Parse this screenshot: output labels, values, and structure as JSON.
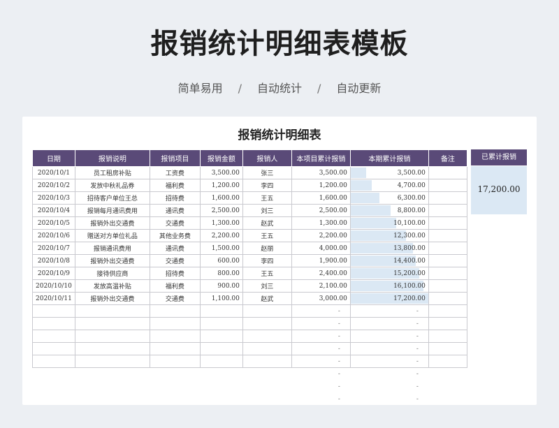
{
  "page": {
    "title": "报销统计明细表模板",
    "subtitle": [
      "简单易用",
      "自动统计",
      "自动更新"
    ],
    "separator": "/"
  },
  "sheet": {
    "title": "报销统计明细表",
    "headers": [
      "日期",
      "报销说明",
      "报销项目",
      "报销金额",
      "报销人",
      "本项目累计报销",
      "本期累计报销",
      "备注"
    ],
    "rows": [
      {
        "date": "2020/10/1",
        "desc": "员工租房补贴",
        "item": "工资费",
        "amount": "3,500.00",
        "person": "张三",
        "item_total": "3,500.00",
        "period_total": "3,500.00",
        "period_ratio": 0.2035,
        "note": ""
      },
      {
        "date": "2020/10/2",
        "desc": "发放中秋礼品券",
        "item": "福利费",
        "amount": "1,200.00",
        "person": "李四",
        "item_total": "1,200.00",
        "period_total": "4,700.00",
        "period_ratio": 0.2733,
        "note": ""
      },
      {
        "date": "2020/10/3",
        "desc": "招待客户单位王总",
        "item": "招待费",
        "amount": "1,600.00",
        "person": "王五",
        "item_total": "1,600.00",
        "period_total": "6,300.00",
        "period_ratio": 0.3663,
        "note": ""
      },
      {
        "date": "2020/10/4",
        "desc": "报销每月通讯费用",
        "item": "通讯费",
        "amount": "2,500.00",
        "person": "刘三",
        "item_total": "2,500.00",
        "period_total": "8,800.00",
        "period_ratio": 0.5116,
        "note": ""
      },
      {
        "date": "2020/10/5",
        "desc": "报销外出交通费",
        "item": "交通费",
        "amount": "1,300.00",
        "person": "赵武",
        "item_total": "1,300.00",
        "period_total": "10,100.00",
        "period_ratio": 0.5872,
        "note": ""
      },
      {
        "date": "2020/10/6",
        "desc": "赠送对方单位礼品",
        "item": "其他业务费",
        "amount": "2,200.00",
        "person": "王五",
        "item_total": "2,200.00",
        "period_total": "12,300.00",
        "period_ratio": 0.7151,
        "note": ""
      },
      {
        "date": "2020/10/7",
        "desc": "报销通讯费用",
        "item": "通讯费",
        "amount": "1,500.00",
        "person": "赵丽",
        "item_total": "4,000.00",
        "period_total": "13,800.00",
        "period_ratio": 0.8023,
        "note": ""
      },
      {
        "date": "2020/10/8",
        "desc": "报销外出交通费",
        "item": "交通费",
        "amount": "600.00",
        "person": "李四",
        "item_total": "1,900.00",
        "period_total": "14,400.00",
        "period_ratio": 0.8372,
        "note": ""
      },
      {
        "date": "2020/10/9",
        "desc": "接待供应商",
        "item": "招待费",
        "amount": "800.00",
        "person": "王五",
        "item_total": "2,400.00",
        "period_total": "15,200.00",
        "period_ratio": 0.8837,
        "note": ""
      },
      {
        "date": "2020/10/10",
        "desc": "发放高温补贴",
        "item": "福利费",
        "amount": "900.00",
        "person": "刘三",
        "item_total": "2,100.00",
        "period_total": "16,100.00",
        "period_ratio": 0.936,
        "note": ""
      },
      {
        "date": "2020/10/11",
        "desc": "报销外出交通费",
        "item": "交通费",
        "amount": "1,100.00",
        "person": "赵武",
        "item_total": "3,000.00",
        "period_total": "17,200.00",
        "period_ratio": 1.0,
        "note": ""
      }
    ],
    "empty_rows": 5,
    "tail_rows": 3,
    "dash": "-",
    "side_header": "已累计报销",
    "side_total": "17,200.00"
  }
}
